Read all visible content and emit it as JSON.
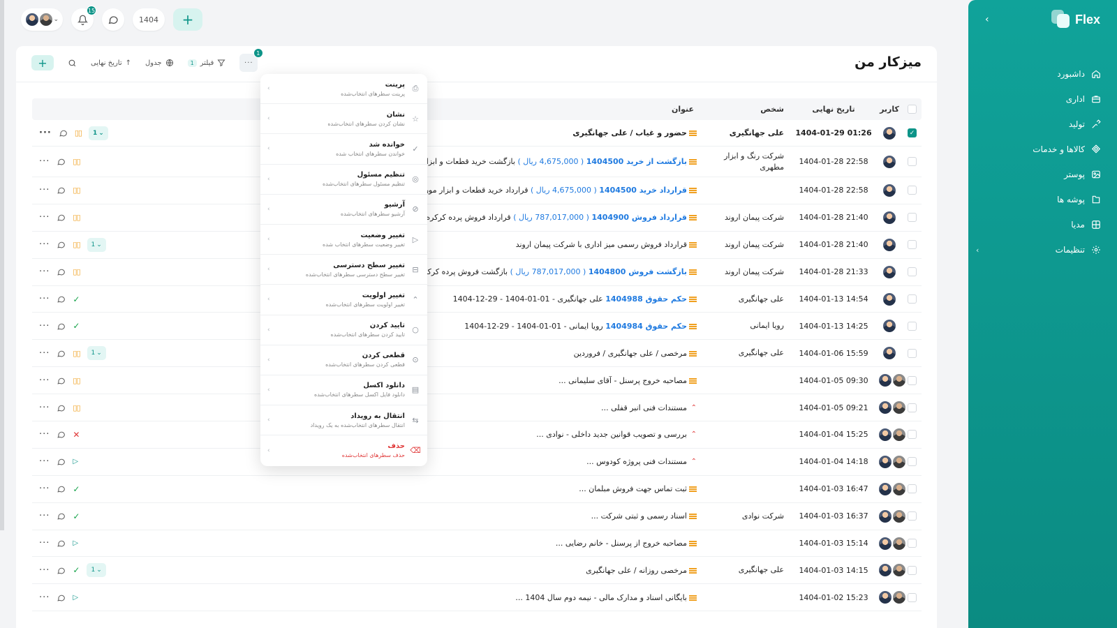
{
  "app": {
    "logo_text": "Flex"
  },
  "topbar": {
    "notification_count": "15",
    "number_pill": "1404"
  },
  "sidebar": {
    "items": [
      {
        "label": "داشبورد",
        "icon": "home-icon"
      },
      {
        "label": "اداری",
        "icon": "briefcase-icon"
      },
      {
        "label": "تولید",
        "icon": "tools-icon"
      },
      {
        "label": "کالاها و خدمات",
        "icon": "box-icon"
      },
      {
        "label": "پوستر",
        "icon": "image-icon"
      },
      {
        "label": "پوشه ها",
        "icon": "folder-icon"
      },
      {
        "label": "مدیا",
        "icon": "media-icon"
      },
      {
        "label": "تنظیمات",
        "icon": "gear-icon"
      }
    ]
  },
  "page": {
    "title": "میزکار من"
  },
  "toolbar": {
    "more_badge": "1",
    "filter_label": "فیلتر",
    "filter_count": "1",
    "view_label": "جدول",
    "sort_label": "تاریخ نهایی"
  },
  "table": {
    "headers": {
      "user": "کاربر",
      "date": "تاریخ نهایی",
      "person": "شخص",
      "title": "عنوان"
    },
    "rows": [
      {
        "date": "1404-01-29 01:26",
        "person": "علی جهانگیری",
        "title": "حضور و غیاب / علی جهانگیری",
        "status": "pause",
        "version": "1",
        "selected": true
      },
      {
        "date": "1404-01-28 22:58",
        "person": "شرکت رنگ و ابزار مطهری",
        "title_link": "بازگشت از خرید 1404500",
        "title_amount": "( 4,675,000 ریال )",
        "title_rest": "بازگشت خرید قطعات و ابزار",
        "status": "pause"
      },
      {
        "date": "1404-01-28 22:58",
        "person": "",
        "title_link": "قرارداد خرید 1404500",
        "title_amount": "( 4,675,000 ریال )",
        "title_rest": "قرارداد خرید قطعات و ابزار مورد",
        "status": "pause"
      },
      {
        "date": "1404-01-28 21:40",
        "person": "شرکت پیمان اروند",
        "title_link": "قرارداد فروش 1404900",
        "title_amount": "( 787,017,000 ریال )",
        "title_rest": "قرارداد فروش پرده کرکره خ",
        "status": "pause"
      },
      {
        "date": "1404-01-28 21:40",
        "person": "شرکت پیمان اروند",
        "title": "قرارداد فروش رسمی میز اداری با شرکت پیمان اروند",
        "status": "pause",
        "version": "1"
      },
      {
        "date": "1404-01-28 21:33",
        "person": "شرکت پیمان اروند",
        "title_link": "بازگشت فروش 1404800",
        "title_amount": "( 787,017,000 ریال )",
        "title_rest": "بازگشت فروش پرده کرکر",
        "status": "pause"
      },
      {
        "date": "1404-01-13 14:54",
        "person": "علی جهانگیری",
        "title_link": "حکم حقوق 1404988",
        "title_rest": "علی جهانگیری - 01-01-1404 - 29-12-1404",
        "status": "ok"
      },
      {
        "date": "1404-01-13 14:25",
        "person": "رویا ایمانی",
        "title_link": "حکم حقوق 1404984",
        "title_rest": "رویا ایمانی - 01-01-1404 - 29-12-1404",
        "status": "ok"
      },
      {
        "date": "1404-01-06 15:59",
        "person": "علی جهانگیری",
        "title": "مرخصی / علی جهانگیری / فروردین",
        "status": "pause",
        "version": "1"
      },
      {
        "date": "1404-01-05 09:30",
        "person": "",
        "title": "مصاحبه خروج پرسنل - آقای سلیمانی ...",
        "status": "pause"
      },
      {
        "date": "1404-01-05 09:21",
        "person": "",
        "title": "مستندات فنی انبر قفلی ...",
        "status": "pause",
        "priority": "high"
      },
      {
        "date": "1404-01-04 15:25",
        "person": "",
        "title": "بررسی و تصویب قوانین جدید داخلی - نوادی ...",
        "status": "x",
        "priority": "high"
      },
      {
        "date": "1404-01-04 14:18",
        "person": "",
        "title": "مستندات فنی پروژه کودوس ...",
        "status": "play",
        "priority": "high"
      },
      {
        "date": "1404-01-03 16:47",
        "person": "",
        "title": "ثبت تماس جهت فروش مبلمان ...",
        "status": "ok"
      },
      {
        "date": "1404-01-03 16:37",
        "person": "شرکت نوادی",
        "title": "اسناد رسمی و ثبتی شرکت ...",
        "status": "ok"
      },
      {
        "date": "1404-01-03 15:14",
        "person": "",
        "title": "مصاحبه خروج از پرسنل - خانم رضایی ...",
        "status": "play"
      },
      {
        "date": "1404-01-03 14:15",
        "person": "علی جهانگیری",
        "title": "مرخصی روزانه / علی جهانگیری",
        "status": "ok",
        "version": "1"
      },
      {
        "date": "1404-01-02 15:23",
        "person": "",
        "title": "بایگانی اسناد و مدارک مالی - نیمه دوم سال 1404 ...",
        "status": "play"
      }
    ]
  },
  "menu": {
    "items": [
      {
        "label": "پرینت",
        "sub": "پرینت سطرهای انتخاب‌شده",
        "icon": "printer-icon"
      },
      {
        "label": "نشان",
        "sub": "نشان کردن سطرهای انتخاب‌شده",
        "icon": "star-icon"
      },
      {
        "label": "خوانده شد",
        "sub": "خواندن سطرهای انتخاب شده",
        "icon": "check-icon"
      },
      {
        "label": "تنظیم مسئول",
        "sub": "تنظیم مسئول سطرهای انتخاب‌شده",
        "icon": "user-icon"
      },
      {
        "label": "آرشیو",
        "sub": "آرشیو سطرهای انتخاب‌شده",
        "icon": "archive-icon"
      },
      {
        "label": "تغییر وضعیت",
        "sub": "تغییر وضعیت سطرهای انتخاب شده",
        "icon": "play-icon"
      },
      {
        "label": "تغییر سطح دسترسی",
        "sub": "تغییر سطح دسترسی سطرهای انتخاب‌شده",
        "icon": "lock-icon"
      },
      {
        "label": "تغییر اولویت",
        "sub": "تغییر اولویت سطرهای انتخاب‌شده",
        "icon": "priority-icon"
      },
      {
        "label": "تایید کردن",
        "sub": "تایید کردن سطرهای انتخاب‌شده",
        "icon": "circle-check-icon"
      },
      {
        "label": "قطعی کردن",
        "sub": "قطعی کردن سطرهای انتخاب‌شده",
        "icon": "seal-icon"
      },
      {
        "label": "دانلود اکسل",
        "sub": "دانلود فایل اکسل سطرهای انتخاب‌شده",
        "icon": "excel-icon"
      },
      {
        "label": "انتقال به رویداد",
        "sub": "انتقال سطرهای انتخاب‌شده به یک رویداد",
        "icon": "transfer-icon"
      },
      {
        "label": "حذف",
        "sub": "حذف سطرهای انتخاب‌شده",
        "icon": "trash-icon",
        "danger": true
      }
    ]
  }
}
